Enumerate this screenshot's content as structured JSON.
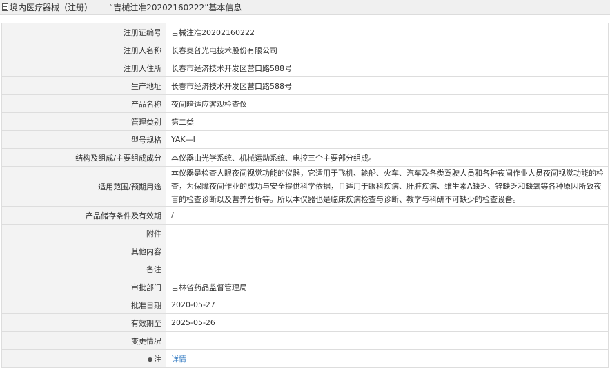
{
  "header": {
    "icon": "document-icon",
    "title": "境内医疗器械（注册）——“吉械注准20202160222”基本信息"
  },
  "fields": {
    "reg_no": {
      "label": "注册证编号",
      "value": "吉械注准20202160222"
    },
    "registrant": {
      "label": "注册人名称",
      "value": "长春奥普光电技术股份有限公司"
    },
    "address": {
      "label": "注册人住所",
      "value": "长春市经济技术开发区营口路588号"
    },
    "production": {
      "label": "生产地址",
      "value": "长春市经济技术开发区营口路588号"
    },
    "product_name": {
      "label": "产品名称",
      "value": "夜间暗适应客观检查仪"
    },
    "category": {
      "label": "管理类别",
      "value": "第二类"
    },
    "model": {
      "label": "型号规格",
      "value": "YAK—I"
    },
    "structure": {
      "label": "结构及组成/主要组成成分",
      "value": "本仪器由光学系统、机械运动系统、电控三个主要部分组成。"
    },
    "usage": {
      "label": "适用范围/预期用途",
      "value": "本仪器是检查人眼夜间视觉功能的仪器，它适用于飞机、轮船、火车、汽车及各类驾驶人员和各种夜间作业人员夜间视觉功能的检查，为保障夜间作业的成功与安全提供科学依据，且适用于眼科疾病、肝脏疾病、维生素A缺乏、锌缺乏和缺氧等各种原因所致夜盲的检查诊断以及营养分析等。所以本仪器也是临床疾病检查与诊断、教学与科研不可缺少的检查设备。"
    },
    "storage": {
      "label": "产品储存条件及有效期",
      "value": "/"
    },
    "attachment": {
      "label": "附件",
      "value": ""
    },
    "other": {
      "label": "其他内容",
      "value": ""
    },
    "remark": {
      "label": "备注",
      "value": ""
    },
    "department": {
      "label": "审批部门",
      "value": "吉林省药品监督管理局"
    },
    "approval_date": {
      "label": "批准日期",
      "value": "2020-05-27"
    },
    "valid_until": {
      "label": "有效期至",
      "value": "2025-05-26"
    },
    "changes": {
      "label": "变更情况",
      "value": ""
    },
    "note": {
      "label": "注",
      "icon": "pin-icon",
      "link_text": "详情"
    }
  },
  "colors": {
    "label_bg": "#f3f3f3",
    "border": "#dddddd",
    "link": "#3a7fc4"
  }
}
